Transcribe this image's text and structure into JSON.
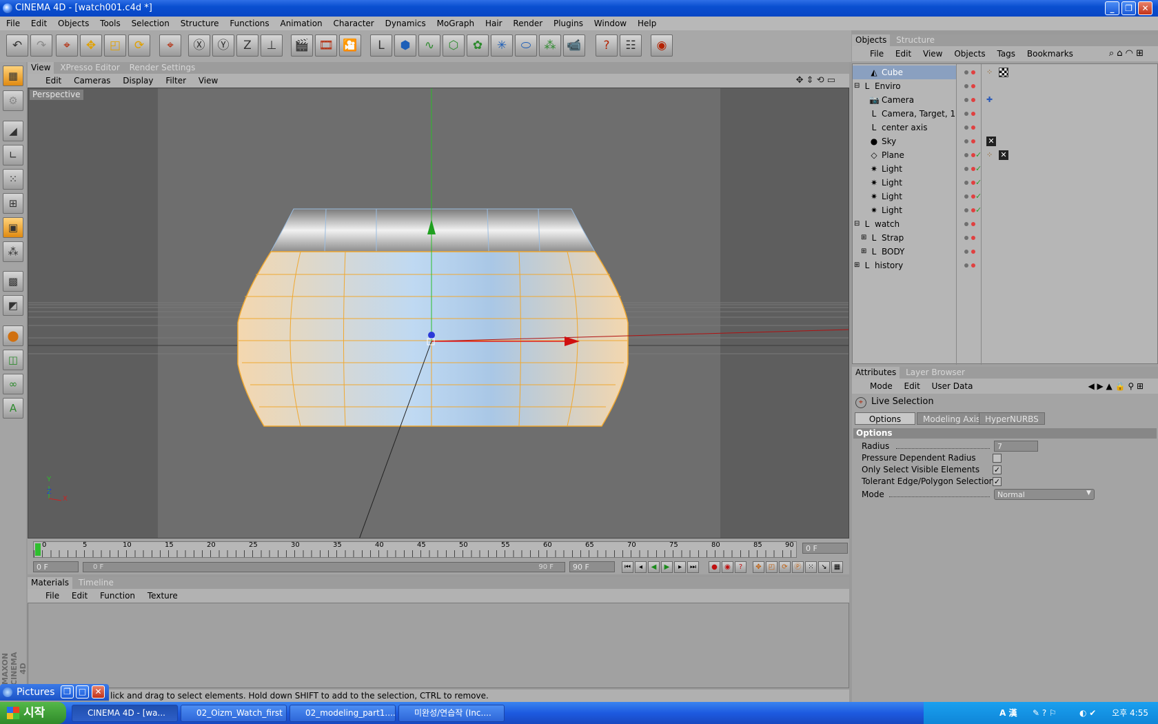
{
  "window": {
    "title": "CINEMA 4D - [watch001.c4d *]"
  },
  "menu": [
    "File",
    "Edit",
    "Objects",
    "Tools",
    "Selection",
    "Structure",
    "Functions",
    "Animation",
    "Character",
    "Dynamics",
    "MoGraph",
    "Hair",
    "Render",
    "Plugins",
    "Window",
    "Help"
  ],
  "viewport": {
    "tabs": [
      "View",
      "XPresso Editor",
      "Render Settings"
    ],
    "menu": [
      "Edit",
      "Cameras",
      "Display",
      "Filter",
      "View"
    ],
    "label": "Perspective",
    "axis_labels": {
      "y": "Y",
      "z": "Z",
      "x": "X"
    }
  },
  "timeline": {
    "ticks": [
      "0",
      "5",
      "10",
      "15",
      "20",
      "25",
      "30",
      "35",
      "40",
      "45",
      "50",
      "55",
      "60",
      "65",
      "70",
      "75",
      "80",
      "85",
      "90"
    ],
    "current_frame": "0 F",
    "start_field": "0 F",
    "range_start": "0 F",
    "range_end": "90 F",
    "end_field": "90 F"
  },
  "materials": {
    "tabs": [
      "Materials",
      "Timeline"
    ],
    "menu": [
      "File",
      "Edit",
      "Function",
      "Texture"
    ]
  },
  "status_text": "lick and drag to select elements. Hold down SHIFT to add to the selection, CTRL to remove.",
  "pictures_window": {
    "title": "Pictures"
  },
  "objects": {
    "tabs": [
      "Objects",
      "Structure"
    ],
    "menu": [
      "File",
      "Edit",
      "View",
      "Objects",
      "Tags",
      "Bookmarks"
    ],
    "items": [
      {
        "name": "Cube",
        "indent": 1,
        "icon": "cube-icon",
        "selected": true
      },
      {
        "name": "Enviro",
        "indent": 0,
        "icon": "null-icon",
        "expanded": true
      },
      {
        "name": "Camera",
        "indent": 1,
        "icon": "camera-icon"
      },
      {
        "name": "Camera, Target, 1",
        "indent": 1,
        "icon": "null-icon"
      },
      {
        "name": "center axis",
        "indent": 1,
        "icon": "null-icon"
      },
      {
        "name": "Sky",
        "indent": 1,
        "icon": "sky-icon"
      },
      {
        "name": "Plane",
        "indent": 1,
        "icon": "plane-icon"
      },
      {
        "name": "Light",
        "indent": 1,
        "icon": "light-icon"
      },
      {
        "name": "Light",
        "indent": 1,
        "icon": "light-icon"
      },
      {
        "name": "Light",
        "indent": 1,
        "icon": "light-icon"
      },
      {
        "name": "Light",
        "indent": 1,
        "icon": "light-icon"
      },
      {
        "name": "watch",
        "indent": 0,
        "icon": "null-icon",
        "expanded": true
      },
      {
        "name": "Strap",
        "indent": 1,
        "icon": "null-icon",
        "collapsed": true
      },
      {
        "name": "BODY",
        "indent": 1,
        "icon": "null-icon",
        "collapsed": true
      },
      {
        "name": "history",
        "indent": 0,
        "icon": "null-icon",
        "collapsed": true
      }
    ]
  },
  "attributes": {
    "tabs": [
      "Attributes",
      "Layer Browser"
    ],
    "menu": [
      "Mode",
      "Edit",
      "User Data"
    ],
    "tool_name": "Live Selection",
    "subtabs": [
      "Options",
      "Modeling Axis",
      "HyperNURBS"
    ],
    "section": "Options",
    "radius_label": "Radius",
    "radius_value": "7",
    "pressure_label": "Pressure Dependent Radius",
    "visible_label": "Only Select Visible Elements",
    "tolerant_label": "Tolerant Edge/Polygon Selection",
    "mode_label": "Mode",
    "mode_value": "Normal"
  },
  "taskbar": {
    "start": "시작",
    "tasks": [
      "CINEMA 4D - [wa...",
      "02_Oizm_Watch_first",
      "02_modeling_part1....",
      "미완성/연습작 (Inc...."
    ],
    "clock": "오후 4:55",
    "ime": "A 漢"
  }
}
